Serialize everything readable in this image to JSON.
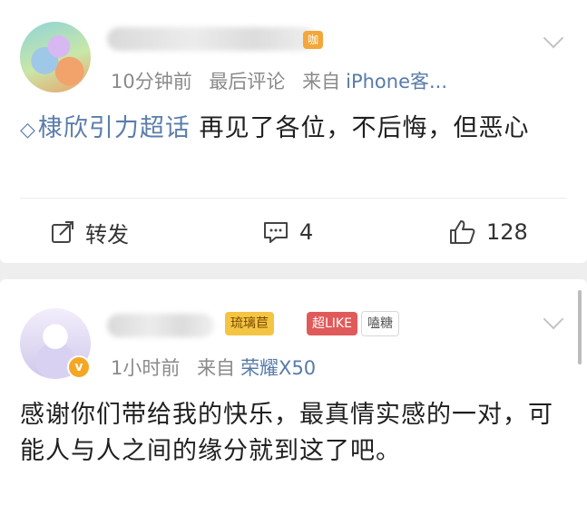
{
  "post1": {
    "avatar": "avatar-cartoon-duo",
    "level_badge": "咖",
    "meta": {
      "time": "10分钟前",
      "tag": "最后评论",
      "from": "来自",
      "source": "iPhone客..."
    },
    "topic_icon": "◇",
    "topic": "棣欣引力超话",
    "text": "  再见了各位，不后悔，但恶心",
    "actions": {
      "repost": "转发",
      "comment_count": "4",
      "like_count": "128"
    }
  },
  "post2": {
    "avatar": "avatar-anime-white-hair",
    "vbadge": "v",
    "badges": {
      "liuli": "琉璃苣",
      "super": "超LIKE",
      "tang": "嗑糖"
    },
    "meta": {
      "time": "1小时前",
      "from": "来自",
      "source": "荣耀X50"
    },
    "text": "感谢你们带给我的快乐，最真情实感的一对，可能人与人之间的缘分就到这了吧。"
  },
  "colors": {
    "link": "#5b7dab",
    "meta": "#8a8a8a",
    "background": "#eeeeee"
  },
  "icons": [
    "chevron-down-icon",
    "repost-icon",
    "comment-icon",
    "like-icon",
    "topic-diamond-icon"
  ]
}
